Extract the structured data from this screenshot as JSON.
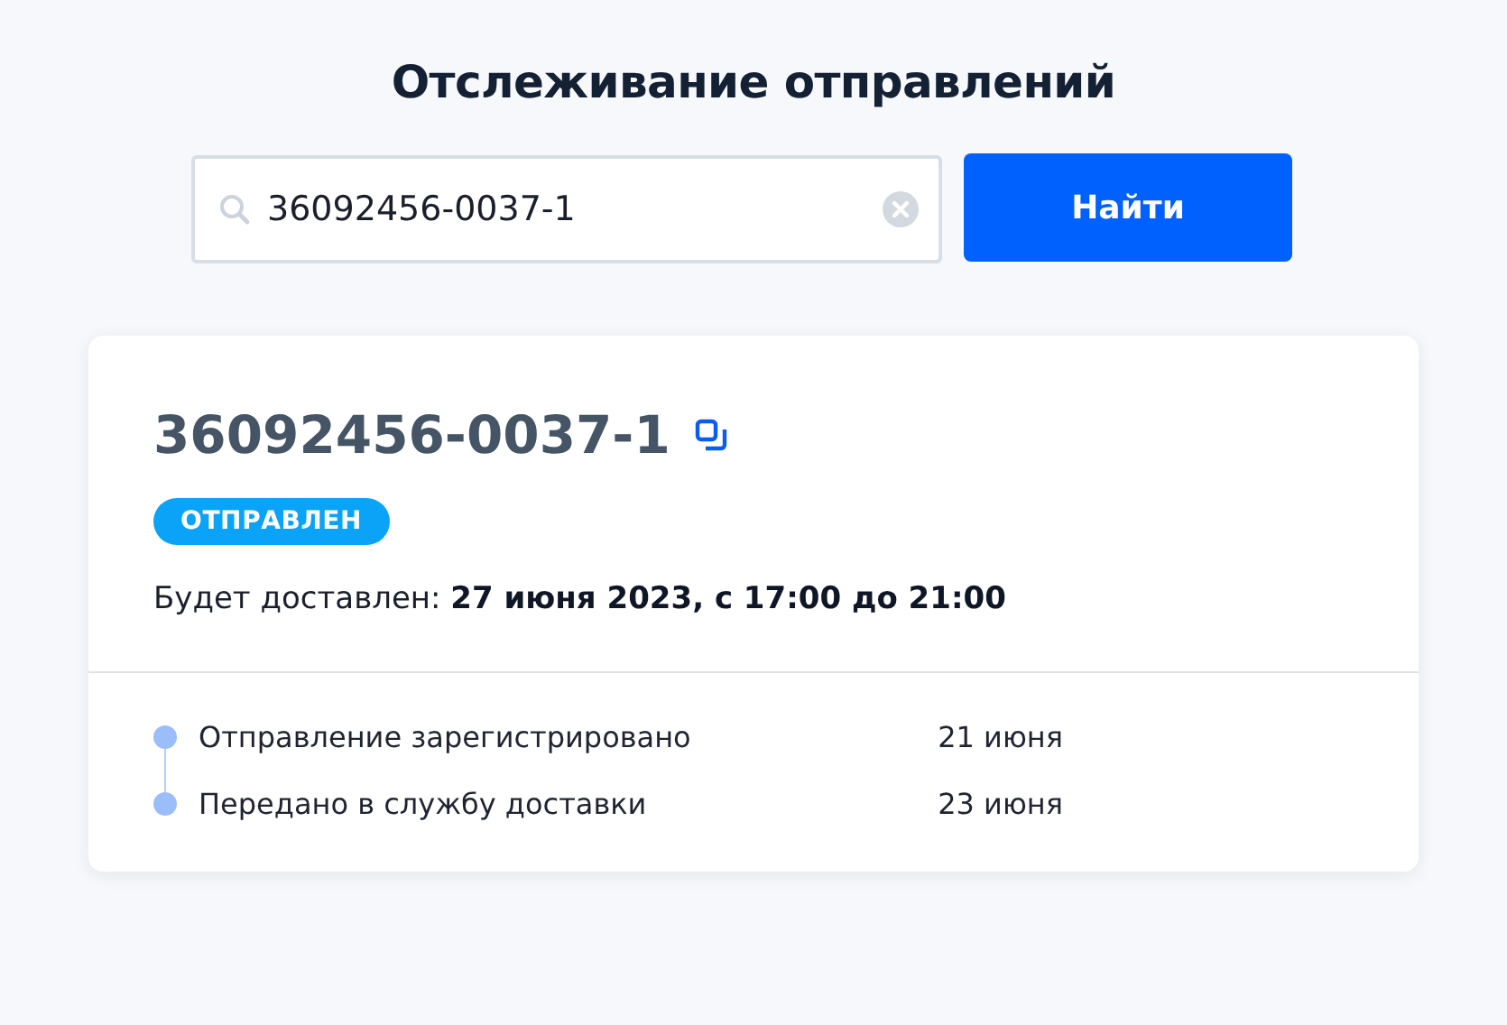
{
  "title": "Отслеживание отправлений",
  "search": {
    "value": "36092456-0037-1"
  },
  "search_button": "Найти",
  "shipment": {
    "number": "36092456-0037-1",
    "status": "ОТПРАВЛЕН",
    "delivery": "Будет доставлен: **27 июня 2023, с 17:00 до 21:00**",
    "events": [
      {
        "label": "Отправление зарегистрировано",
        "date": "21 июня"
      },
      {
        "label": "Передано в службу доставки",
        "date": "23 июня"
      }
    ]
  }
}
